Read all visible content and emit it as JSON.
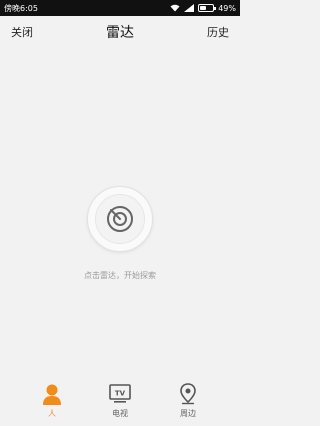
{
  "status_bar": {
    "time": "傍晚6:05",
    "battery": "49%",
    "battery_level": 0.49,
    "icons": [
      "wifi-icon",
      "signal-icon",
      "battery-icon"
    ]
  },
  "header": {
    "close_label": "关闭",
    "title": "雷达",
    "history_label": "历史"
  },
  "radar": {
    "icon": "radar-icon",
    "hint": "点击雷达，开始探索"
  },
  "bottom_nav": {
    "items": [
      {
        "label": "人",
        "icon": "person-icon",
        "active": true
      },
      {
        "label": "电视",
        "icon": "tv-icon",
        "active": false
      },
      {
        "label": "周边",
        "icon": "location-pin-icon",
        "active": false
      }
    ]
  },
  "colors": {
    "accent": "#f08c1a",
    "background": "#f2f2f2",
    "status_bar": "#111111",
    "inactive_icon": "#555555",
    "hint_text": "#9a9a9a"
  }
}
